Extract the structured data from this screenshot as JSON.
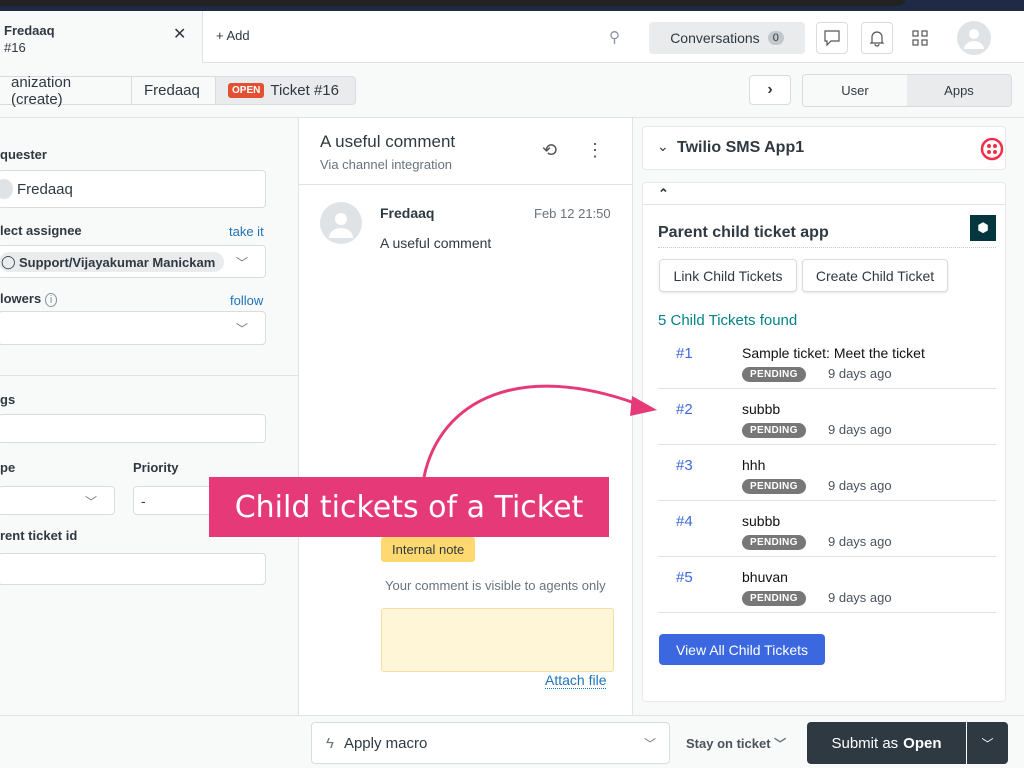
{
  "header": {
    "tab_title": "Fredaaq",
    "tab_sub": "#16",
    "add_label": "Add",
    "conversations_label": "Conversations",
    "conversations_count": "0"
  },
  "breadcrumbs": [
    "anization (create)",
    "Fredaaq",
    "Ticket #16"
  ],
  "status_badge": "OPEN",
  "context_tabs": [
    "User",
    "Apps"
  ],
  "left": {
    "requester_label": "quester",
    "requester_value": "Fredaaq",
    "assignee_label": "lect assignee",
    "take_it": "take it",
    "assignee_value": "Support/Vijayakumar Manickam",
    "followers_label": "lowers",
    "follow": "follow",
    "tags_label": "gs",
    "type_label": "pe",
    "priority_label": "Priority",
    "priority_value": "-",
    "parent_label": "rent ticket id"
  },
  "conversation": {
    "title": "A useful comment",
    "via": "Via channel integration",
    "author": "Fredaaq",
    "time": "Feb 12 21:50",
    "body": "A useful comment",
    "internal_note": "Internal note",
    "visibility": "Your comment is visible to agents only",
    "attach": "Attach file"
  },
  "apps": {
    "twilio_title": "Twilio SMS App1",
    "app_title": "Parent child ticket app",
    "link_btn": "Link Child Tickets",
    "create_btn": "Create Child Ticket",
    "found": "5 Child Tickets found",
    "view_all": "View All Child Tickets",
    "tickets": [
      {
        "id": "#1",
        "title": "Sample ticket: Meet the ticket",
        "status": "PENDING",
        "age": "9 days ago"
      },
      {
        "id": "#2",
        "title": "subbb",
        "status": "PENDING",
        "age": "9 days ago"
      },
      {
        "id": "#3",
        "title": "hhh",
        "status": "PENDING",
        "age": "9 days ago"
      },
      {
        "id": "#4",
        "title": "subbb",
        "status": "PENDING",
        "age": "9 days ago"
      },
      {
        "id": "#5",
        "title": "bhuvan",
        "status": "PENDING",
        "age": "9 days ago"
      }
    ]
  },
  "footer": {
    "macro": "Apply macro",
    "stay": "Stay on ticket",
    "submit_prefix": "Submit as",
    "submit_status": "Open"
  },
  "annotation": "Child tickets of a Ticket",
  "colors": {
    "accent": "#1f73b7",
    "open": "#e34f32",
    "annotation": "#e63a78",
    "teal": "#038387",
    "primary_button": "#3b68e0",
    "submit": "#2f3941"
  }
}
